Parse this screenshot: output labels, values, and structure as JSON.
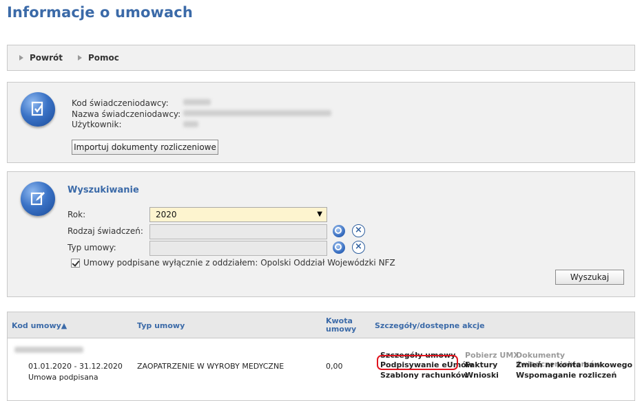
{
  "page": {
    "title": "Informacje o umowach"
  },
  "nav": {
    "back_label": "Powrót",
    "help_label": "Pomoc"
  },
  "info": {
    "provider_code_label": "Kod świadczeniodawcy:",
    "provider_name_label": "Nazwa świadczeniodawcy:",
    "user_label": "Użytkownik:",
    "import_button": "Importuj dokumenty rozliczeniowe"
  },
  "search": {
    "title": "Wyszukiwanie",
    "year_label": "Rok:",
    "year_value": "2020",
    "benefit_type_label": "Rodzaj świadczeń:",
    "benefit_type_value": "",
    "contract_type_label": "Typ umowy:",
    "contract_type_value": "",
    "checkbox_label": "Umowy podpisane wyłącznie z oddziałem: Opolski Oddział Wojewódzki NFZ",
    "checkbox_checked": true,
    "search_button": "Wyszukaj"
  },
  "results": {
    "columns": {
      "code": "Kod umowy▲",
      "type": "Typ umowy",
      "amount_line1": "Kwota",
      "amount_line2": "umowy",
      "actions": "Szczegóły/dostępne akcje"
    },
    "rows": [
      {
        "period": "01.01.2020 - 31.12.2020",
        "status": "Umowa podpisana",
        "type": "ZAOPATRZENIE W WYROBY MEDYCZNE",
        "amount": "0,00",
        "actions": {
          "details": "Szczegóły umowy",
          "signing": "Podpisywanie eUmów",
          "templates": "Szablony rachunków",
          "download_umx": "Pobierz UMX",
          "invoices": "Faktury",
          "applications": "Wnioski",
          "beneficiary_docs": "Dokumenty świadczeniobiorców",
          "change_account": "Zmień nr konta bankowego",
          "settlement_support": "Wspomaganie rozliczeń"
        }
      }
    ]
  },
  "colors": {
    "title_blue": "#3b6aa8",
    "highlight_red": "#e0141e",
    "select_bg": "#fdf4cf"
  }
}
